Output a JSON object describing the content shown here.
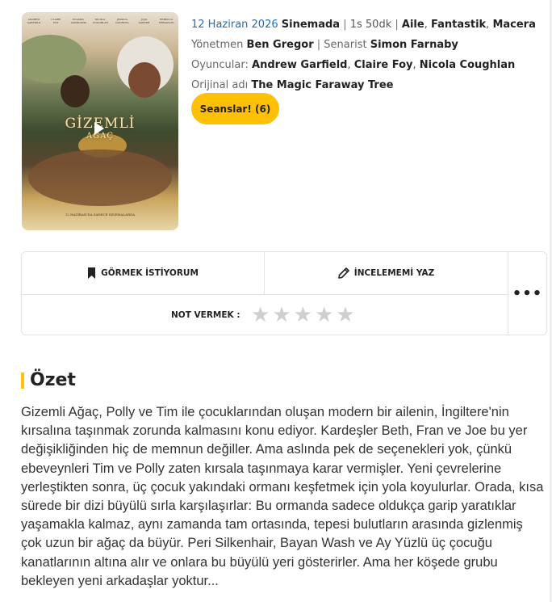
{
  "poster": {
    "alt": "Gizemli Ağaç film posteri",
    "cast_names": [
      "ANDREW GARFIELD",
      "CLAIRE FOY",
      "NNAMDI ASOMUGHA",
      "NICOLA COUGHLAN",
      "JESSICA GUNNING",
      "JOJO SAWYER",
      "REBECCA FERGUSON"
    ],
    "title_line1": "GİZEMLİ",
    "title_line2": "AĞAÇ",
    "release_text": "12 HAZİRAN'DA SADECE SİNEMALARDA"
  },
  "info": {
    "release_date": "12 Haziran 2026",
    "release_status": "Sinemada",
    "duration": "1s 50dk",
    "genres": [
      "Aile",
      "Fantastik",
      "Macera"
    ],
    "director_label": "Yönetmen",
    "director": "Ben Gregor",
    "writer_label": "Senarist",
    "writer": "Simon Farnaby",
    "cast_label": "Oyuncular:",
    "cast": [
      "Andrew Garfield",
      "Claire Foy",
      "Nicola Coughlan"
    ],
    "original_title_label": "Orijinal adı",
    "original_title": "The Magic Faraway Tree",
    "sessions_button": "Seanslar! (6)"
  },
  "actions": {
    "watchlist_label": "GÖRMEK İSTİYORUM",
    "review_label": "İNCELEMEMİ YAZ",
    "more_label": "•••",
    "rating_label": "NOT VERMEK :",
    "star_count": 5,
    "rating_value": 0,
    "icon_watchlist": "bookmark-icon",
    "icon_review": "pencil-icon"
  },
  "summary": {
    "heading": "Özet",
    "text": "Gizemli Ağaç, Polly ve Tim ile çocuklarından oluşan modern bir ailenin, İngiltere'nin kırsalına taşınmak zorunda kalmasını konu ediyor. Kardeşler Beth, Fran ve Joe bu yer değişikliğinden hiç de memnun değiller. Ama aslında pek de seçenekleri yok, çünkü ebeveynleri Tim ve Polly zaten kırsala taşınmaya karar vermişler. Yeni çevrelerine yerleştikten sonra, üç çocuk yakındaki ormanı keşfetmek için yola koyulurlar. Orada, kısa sürede bir dizi büyülü sırla karşılaşırlar: Bu ormanda sadece oldukça garip yaratıklar yaşamakla kalmaz, aynı zamanda tam ortasında, tepesi bulutların arasında gizlenmiş çok uzun bir ağaç da büyür. Peri Silkenhair, Bayan Wash ve Ay Yüzlü üç çocuğu kanatlarının altına alır ve onlara bu büyülü yeri gösterirler. Ama her köşede grubu bekleyen yeni arkadaşlar yoktur..."
  },
  "colors": {
    "accent": "#ffc107",
    "link": "#1f6fb5",
    "star_empty": "#cfcfcf"
  }
}
